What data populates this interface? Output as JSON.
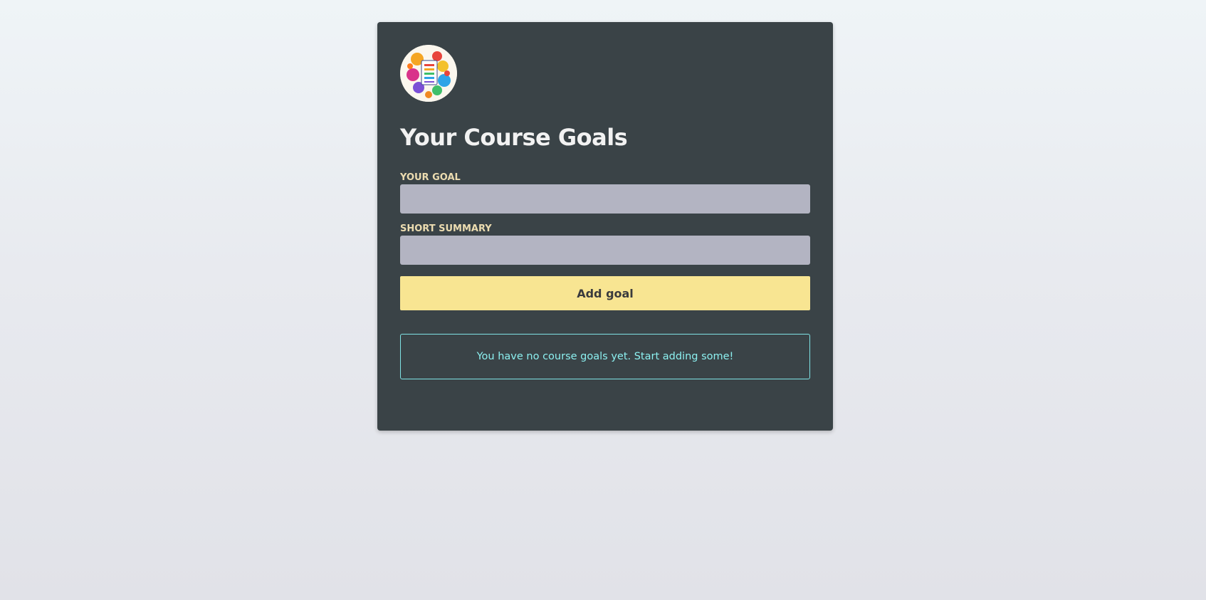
{
  "header": {
    "logo_icon": "colorful-goals-checklist-logo",
    "title": "Your Course Goals"
  },
  "form": {
    "goal_label": "Your goal",
    "goal_value": "",
    "summary_label": "Short summary",
    "summary_value": "",
    "submit_label": "Add goal"
  },
  "goals": {
    "items": [],
    "empty_message": "You have no course goals yet. Start adding some!"
  },
  "colors": {
    "page_background": "#eaedf1",
    "card_background": "#3a4347",
    "title_text": "#f2f2f2",
    "label_text": "#ecdcb0",
    "input_background": "#b3b4c2",
    "button_background": "#f8e592",
    "empty_border": "#7fe3e5",
    "empty_text": "#8cf0f0"
  }
}
